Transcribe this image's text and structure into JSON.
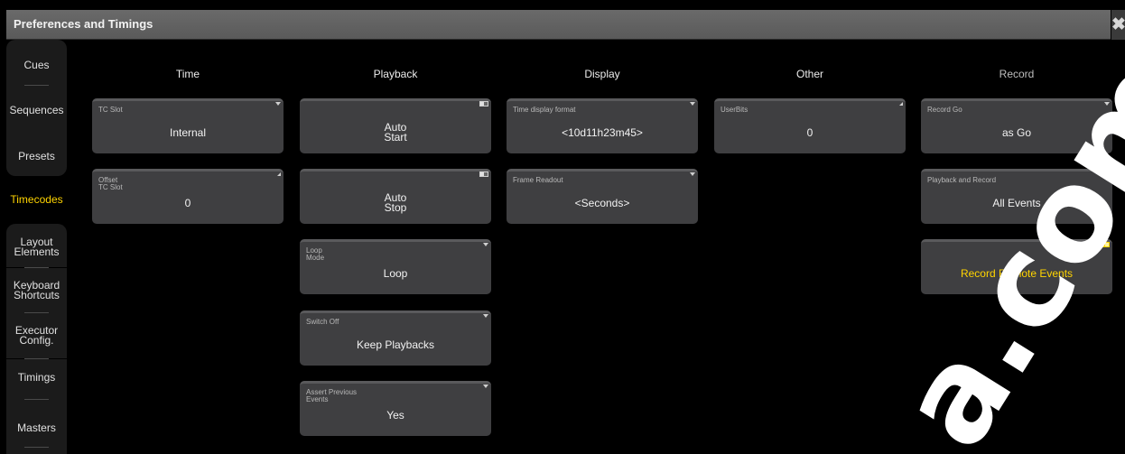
{
  "window": {
    "title": "Preferences and Timings",
    "close_glyph": "✖"
  },
  "sidebar": {
    "items": [
      {
        "label": "Cues"
      },
      {
        "label": "Sequences"
      },
      {
        "label": "Presets"
      },
      {
        "label": "Timecodes"
      },
      {
        "label": "Layout\nElements"
      },
      {
        "label": "Keyboard\nShortcuts"
      },
      {
        "label": "Executor\nConfig."
      },
      {
        "label": "Timings"
      },
      {
        "label": "Masters"
      }
    ],
    "selected": "Timecodes"
  },
  "columns": {
    "time": {
      "header": "Time",
      "buttons": [
        {
          "label": "TC Slot",
          "value": "Internal",
          "indicator": "triangle"
        },
        {
          "label": "Offset\nTC Slot",
          "value": "0",
          "indicator": "corner"
        }
      ]
    },
    "playback": {
      "header": "Playback",
      "buttons": [
        {
          "label": "",
          "value": "Auto\nStart",
          "indicator": "toggle-off"
        },
        {
          "label": "",
          "value": "Auto\nStop",
          "indicator": "toggle-off"
        },
        {
          "label": "Loop\nMode",
          "value": "Loop",
          "indicator": "triangle"
        },
        {
          "label": "Switch Off",
          "value": "Keep Playbacks",
          "indicator": "triangle"
        },
        {
          "label": "Assert Previous\nEvents",
          "value": "Yes",
          "indicator": "triangle"
        }
      ]
    },
    "display": {
      "header": "Display",
      "buttons": [
        {
          "label": "Time display format",
          "value": "<10d11h23m45>",
          "indicator": "triangle"
        },
        {
          "label": "Frame Readout",
          "value": "<Seconds>",
          "indicator": "triangle"
        }
      ]
    },
    "other": {
      "header": "Other",
      "buttons": [
        {
          "label": "UserBits",
          "value": "0",
          "indicator": "corner"
        }
      ]
    },
    "record": {
      "header": "Record",
      "buttons": [
        {
          "label": "Record Go",
          "value": "as Go",
          "indicator": "triangle"
        },
        {
          "label": "Playback and Record",
          "value": "All Events",
          "indicator": "triangle"
        },
        {
          "label": "",
          "value": "Record Remote Events",
          "indicator": "toggle-on",
          "active": true
        }
      ]
    }
  },
  "watermark": {
    "text": "a.com",
    "color": "#ffffff"
  },
  "colors": {
    "background": "#000000",
    "button": "#3f3f41",
    "selected_text": "#ffd400",
    "titlebar": "#626262"
  }
}
